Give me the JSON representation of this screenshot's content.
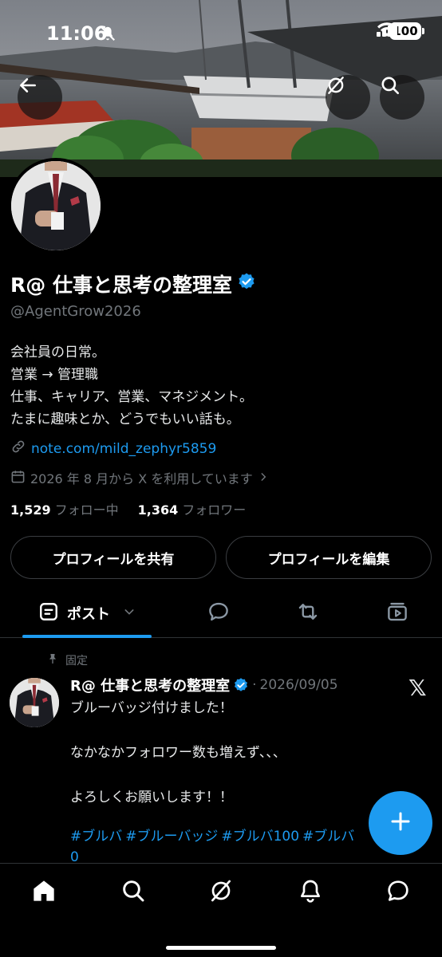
{
  "status_bar": {
    "time": "11:06",
    "battery": "100"
  },
  "profile": {
    "display_name": "R@ 仕事と思考の整理室",
    "handle": "@AgentGrow2026",
    "bio_lines": [
      "会社員の日常。",
      "営業 → 管理職",
      "仕事、キャリア、営業、マネジメント。",
      "たまに趣味とか、どうでもいい話も。"
    ],
    "link": "note.com/mild_zephyr5859",
    "joined": "2026 年 8 月から X を利用しています",
    "following_count": "1,529",
    "following_label": "フォロー中",
    "followers_count": "1,364",
    "followers_label": "フォロワー",
    "share_button": "プロフィールを共有",
    "edit_button": "プロフィールを編集"
  },
  "tabs": [
    {
      "label": "ポスト",
      "icon": "posts-icon",
      "active": true
    },
    {
      "icon": "reply-icon"
    },
    {
      "icon": "repost-icon"
    },
    {
      "icon": "media-icon"
    }
  ],
  "post": {
    "pinned_label": "固定",
    "author": "R@ 仕事と思考の整理室",
    "separator": "·",
    "date": "2026/09/05",
    "body_lines": [
      "ブルーバッジ付けました！",
      "",
      "なかなかフォロワー数も増えず、、、",
      "",
      "よろしくお願いします！！"
    ],
    "hashtags": [
      "#ブルバ",
      "#ブルーバッジ",
      "#ブルバ100",
      "#ブルバ",
      "0"
    ]
  },
  "colors": {
    "accent": "#1d9bf0",
    "background": "#000000",
    "muted": "#71767b"
  },
  "nav": [
    "home-icon",
    "search-icon",
    "grok-icon",
    "notifications-icon",
    "messages-icon"
  ]
}
